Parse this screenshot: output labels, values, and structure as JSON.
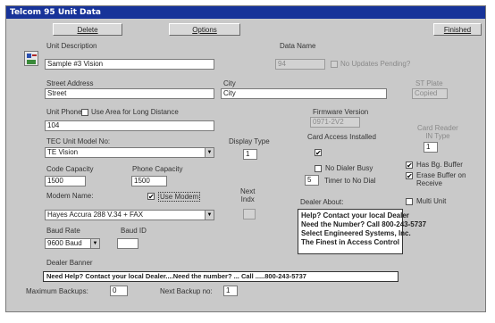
{
  "window": {
    "title": "Telcom 95 Unit Data"
  },
  "toolbar": {
    "delete": "Delete",
    "options": "Options",
    "finished": "Finished"
  },
  "unit": {
    "description_label": "Unit Description",
    "description_value": "Sample #3 Vision",
    "data_name_label": "Data Name",
    "data_name_value": "94",
    "no_updates_label": "No Updates Pending?",
    "street_label": "Street Address",
    "street_value": "Street",
    "city_label": "City",
    "city_value": "City",
    "state_label": "ST Plate",
    "state_value": "Copied",
    "unit_phone_label": "Unit Phone:",
    "long_distance_label": "Use Area for Long Distance",
    "unit_phone_value": "104",
    "firmware_label": "Firmware Version",
    "firmware_value": "0971-2V2",
    "card_reader_label": "Card Reader\nIN Type",
    "card_reader_value": "1",
    "tec_model_label": "TEC Unit Model No:",
    "tec_model_value": "TE Vision",
    "display_type_label": "Display Type",
    "display_type_value": "1",
    "card_access_label": "Card Access Installed",
    "code_capacity_label": "Code Capacity",
    "code_capacity_value": "1500",
    "phone_capacity_label": "Phone Capacity",
    "phone_capacity_value": "1500",
    "no_dialer_label": "No Dialer Busy",
    "has_bg_buffer_label": "Has Bg. Buffer",
    "timer_value": "5",
    "timer_label": "Timer to No Dial",
    "erase_buffer_label": "Erase Buffer on Receive",
    "modem_name_label": "Modem Name:",
    "use_modem_label": "Use Modem",
    "modem_value": "Hayes Accura 288 V.34 + FAX",
    "next_index_label": "Next\nIndx",
    "next_index_value": "",
    "multi_unit_label": "Multi Unit",
    "baud_rate_label": "Baud Rate",
    "baud_rate_value": "9600 Baud",
    "baud_id_label": "Baud ID",
    "baud_id_value": "",
    "dealer_about_label": "Dealer About:",
    "dealer_about_value": "Help? Contact your local Dealer\nNeed the Number? Call 800-243-5737\nSelect Engineered Systems, Inc.\nThe Finest in Access Control",
    "dealer_banner_label": "Dealer Banner",
    "dealer_banner_value": "Need Help? Contact your local Dealer....Need the number? ... Call .....800-243-5737",
    "max_backups_label": "Maximum Backups:",
    "max_backups_value": "0",
    "next_backup_label": "Next Backup no:",
    "next_backup_value": "1"
  },
  "checks": {
    "checked": "✔"
  }
}
